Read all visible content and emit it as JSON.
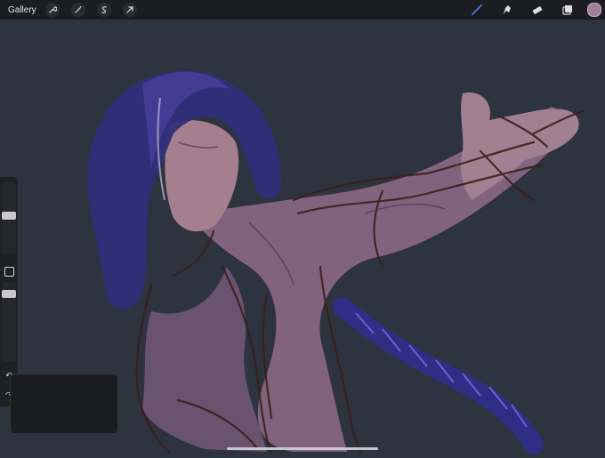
{
  "topbar": {
    "gallery_label": "Gallery",
    "left_tools": [
      "wrench-icon",
      "magic-wand-icon",
      "selection-icon",
      "transform-arrow-icon"
    ],
    "right_tools": [
      "brush-icon",
      "smudge-icon",
      "eraser-icon",
      "layers-icon"
    ],
    "active_tool": "brush-icon",
    "current_color": "#a27e9c"
  },
  "sidebar": {
    "brush_size_slider": "size",
    "opacity_slider": "opacity",
    "modify_button": "square-icon",
    "undo": "undo-icon",
    "redo": "redo-icon"
  },
  "colors": {
    "canvas_background": "#2e3340",
    "topbar_background": "#1c1d21",
    "active_tool_accent": "#3d7bf0"
  }
}
